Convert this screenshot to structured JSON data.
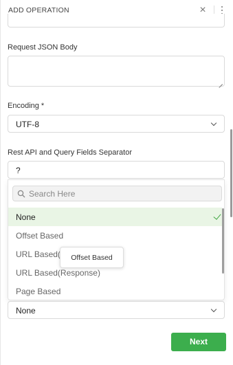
{
  "header": {
    "title": "ADD OPERATION",
    "close_glyph": "×"
  },
  "fields": {
    "request_body_label": "Request JSON Body",
    "encoding_label": "Encoding *",
    "encoding_value": "UTF-8",
    "separator_label": "Rest API and Query Fields Separator",
    "separator_value": "?"
  },
  "dropdown": {
    "search_placeholder": "Search Here",
    "options": [
      {
        "label": "None",
        "selected": true
      },
      {
        "label": "Offset Based",
        "selected": false
      },
      {
        "label": "URL Based(H",
        "selected": false
      },
      {
        "label": "URL Based(Response)",
        "selected": false
      },
      {
        "label": "Page Based",
        "selected": false
      }
    ]
  },
  "tooltip": {
    "text": "Offset Based"
  },
  "pagination": {
    "value": "None"
  },
  "footer": {
    "next_label": "Next"
  },
  "colors": {
    "accent": "#3cae4d",
    "selected_bg": "#e9f5e5",
    "check": "#3fa641"
  }
}
